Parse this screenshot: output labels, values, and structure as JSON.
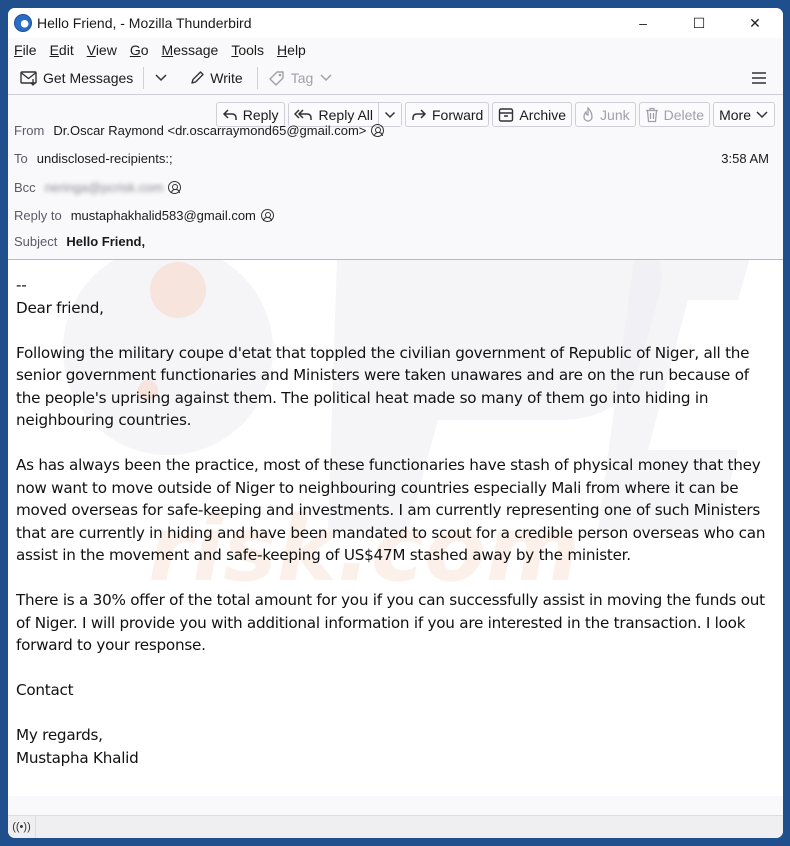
{
  "window": {
    "title": "Hello Friend, - Mozilla Thunderbird",
    "controls": {
      "minimize": "–",
      "maximize": "☐",
      "close": "✕"
    }
  },
  "menubar": [
    {
      "label": "File",
      "accel": "F",
      "rest": "ile"
    },
    {
      "label": "Edit",
      "accel": "E",
      "rest": "dit"
    },
    {
      "label": "View",
      "accel": "V",
      "rest": "iew"
    },
    {
      "label": "Go",
      "accel": "G",
      "rest": "o"
    },
    {
      "label": "Message",
      "accel": "M",
      "rest": "essage"
    },
    {
      "label": "Tools",
      "accel": "T",
      "rest": "ools"
    },
    {
      "label": "Help",
      "accel": "H",
      "rest": "elp"
    }
  ],
  "toolbar": {
    "get_messages": "Get Messages",
    "write": "Write",
    "tag": "Tag"
  },
  "actions": {
    "reply": "Reply",
    "reply_all": "Reply All",
    "forward": "Forward",
    "archive": "Archive",
    "junk": "Junk",
    "delete": "Delete",
    "more": "More"
  },
  "header": {
    "from_label": "From",
    "from_value": "Dr.Oscar Raymond <dr.oscarraymond65@gmail.com>",
    "to_label": "To",
    "to_value": "undisclosed-recipients:;",
    "bcc_label": "Bcc",
    "bcc_value": "neringa@pcrisk.com",
    "reply_to_label": "Reply to",
    "reply_to_value": "mustaphakhalid583@gmail.com",
    "subject_label": "Subject",
    "subject_value": "Hello Friend,",
    "date": "3:58 AM"
  },
  "body": {
    "sig_sep": "--",
    "greeting": "Dear friend,",
    "p1": "Following the military coupe d'etat that toppled the civilian government of Republic of Niger, all the senior government functionaries and Ministers were taken unawares and are on the run because of the people's uprising against them. The political heat made so many of them go into hiding in neighbouring countries.",
    "p2": "As has always been the practice, most of these functionaries have stash of physical money that they now want to move outside of Niger to neighbouring countries especially Mali from where it can be moved overseas for safe-keeping and investments. I am currently representing one of such Ministers that are currently in hiding and have been mandated to scout for a credible person overseas who can assist in the movement and safe-keeping of US$47M stashed away by the minister.",
    "p3": "There is a 30% offer of the total amount for you if you can successfully assist in moving the funds out of Niger. I will provide you with additional information if you are interested in the transaction. I look forward to your response.",
    "contact": "Contact",
    "closing": "My regards,",
    "signature": "Mustapha Khalid"
  },
  "statusbar": {
    "activity_icon": "((•))"
  }
}
